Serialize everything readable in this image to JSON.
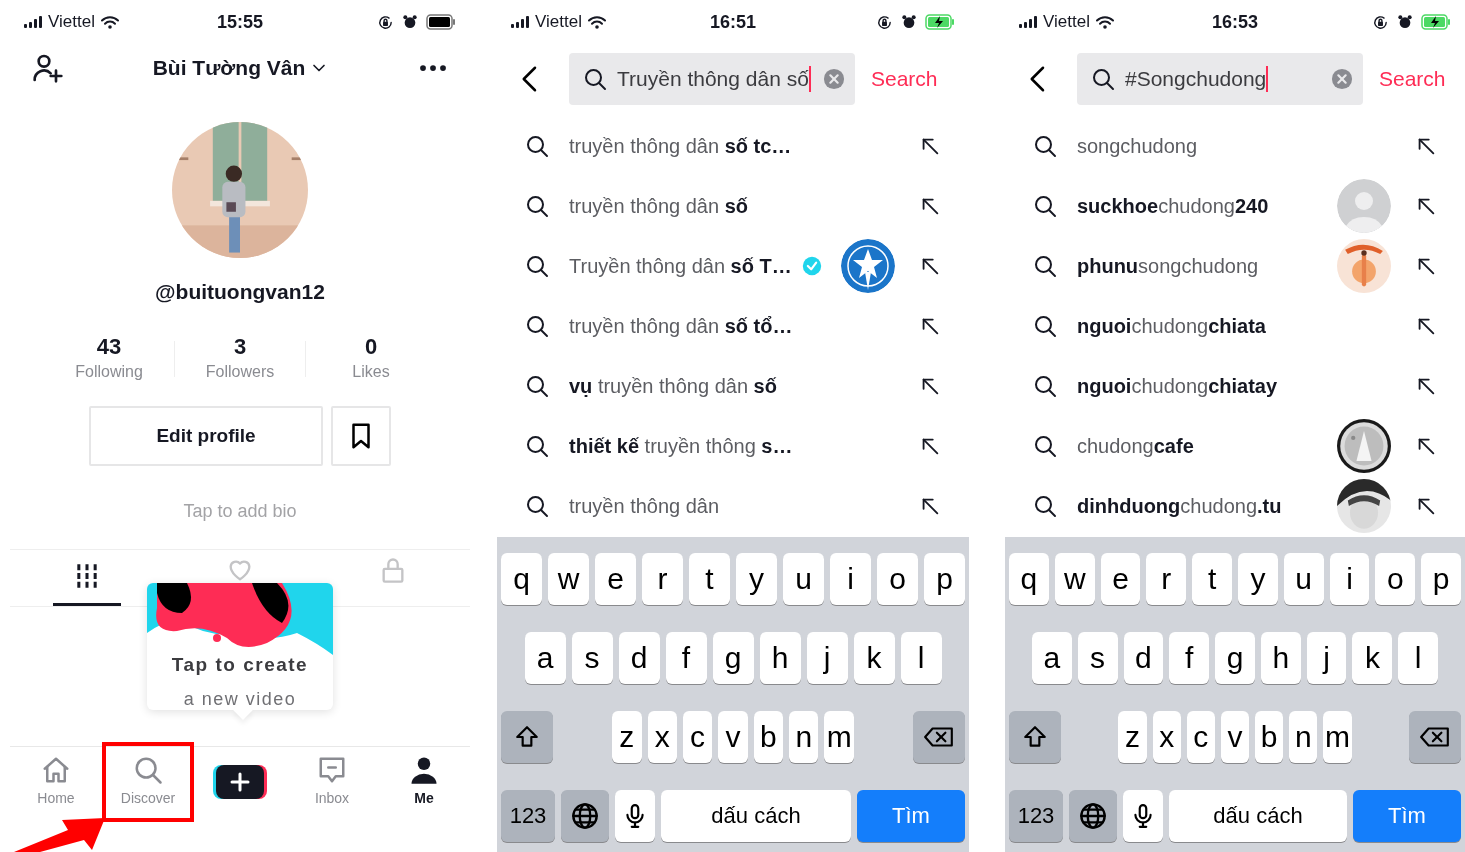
{
  "screens": [
    {
      "kind": "profile",
      "status_bar": {
        "carrier": "Viettel",
        "time": "15:55",
        "charging": false
      },
      "header": {
        "title": "Bùi Tường Vân"
      },
      "username": "@buituongvan12",
      "stats": [
        {
          "value": "43",
          "label": "Following"
        },
        {
          "value": "3",
          "label": "Followers"
        },
        {
          "value": "0",
          "label": "Likes"
        }
      ],
      "edit_button": "Edit profile",
      "bio_hint": "Tap to add bio",
      "content_tabs": [
        {
          "kind": "videos",
          "selected": true
        },
        {
          "kind": "liked",
          "selected": false
        },
        {
          "kind": "private",
          "selected": false
        }
      ],
      "tip": {
        "title": "Tap to create",
        "subtitle": "a new video"
      },
      "nav": [
        {
          "kind": "home",
          "label": "Home",
          "selected": false,
          "highlighted": false
        },
        {
          "kind": "discover",
          "label": "Discover",
          "selected": false,
          "highlighted": true
        },
        {
          "kind": "create",
          "selected": false,
          "highlighted": false
        },
        {
          "kind": "inbox",
          "label": "Inbox",
          "selected": false,
          "highlighted": false
        },
        {
          "kind": "me",
          "label": "Me",
          "selected": true,
          "highlighted": false
        }
      ]
    },
    {
      "kind": "search",
      "status_bar": {
        "carrier": "Viettel",
        "time": "16:51",
        "charging": true
      },
      "query": "Truyền thông dân số",
      "search_button": "Search",
      "suggestions": [
        {
          "text": "truyền thông dân **số tc…**",
          "verified": false
        },
        {
          "text": "truyền thông dân **số**",
          "verified": false
        },
        {
          "text": "Truyền thông dân **số T…**",
          "verified": true,
          "avatar": {
            "kind": "emblem"
          }
        },
        {
          "text": "truyền thông dân **số tổ…**",
          "verified": false
        },
        {
          "text": "**vụ** truyền thông dân **số**",
          "verified": false
        },
        {
          "text": "**thiết kế** truyền thông **s…**",
          "verified": false
        },
        {
          "text": "truyền thông dân",
          "verified": false
        }
      ],
      "keyboard": {
        "rows": [
          [
            "q",
            "w",
            "e",
            "r",
            "t",
            "y",
            "u",
            "i",
            "o",
            "p"
          ],
          [
            "a",
            "s",
            "d",
            "f",
            "g",
            "h",
            "j",
            "k",
            "l"
          ],
          [
            "z",
            "x",
            "c",
            "v",
            "b",
            "n",
            "m"
          ]
        ],
        "numbers_key": "123",
        "space_key": "dấu cách",
        "return_key": "Tìm"
      }
    },
    {
      "kind": "search",
      "status_bar": {
        "carrier": "Viettel",
        "time": "16:53",
        "charging": true
      },
      "query": "#Songchudong",
      "search_button": "Search",
      "suggestions": [
        {
          "text": "songchudong",
          "verified": false
        },
        {
          "text": "**suckhoe**chudong**240**",
          "verified": false,
          "avatar": {
            "kind": "default"
          }
        },
        {
          "text": "**phunu**songchudong",
          "verified": false
        },
        {
          "text": "**nguoi**chudong**chiata**",
          "verified": false
        },
        {
          "text": "**nguoi**chudong**chiatay**",
          "verified": false
        },
        {
          "text": "chudong**cafe**",
          "verified": false
        },
        {
          "text": "**dinhduong**chudong**.tu**",
          "verified": false
        }
      ],
      "keyboard": {
        "rows": [
          [
            "q",
            "w",
            "e",
            "r",
            "t",
            "y",
            "u",
            "i",
            "o",
            "p"
          ],
          [
            "a",
            "s",
            "d",
            "f",
            "g",
            "h",
            "j",
            "k",
            "l"
          ],
          [
            "z",
            "x",
            "c",
            "v",
            "b",
            "n",
            "m"
          ]
        ],
        "numbers_key": "123",
        "space_key": "dấu cách",
        "return_key": "Tìm"
      }
    }
  ]
}
